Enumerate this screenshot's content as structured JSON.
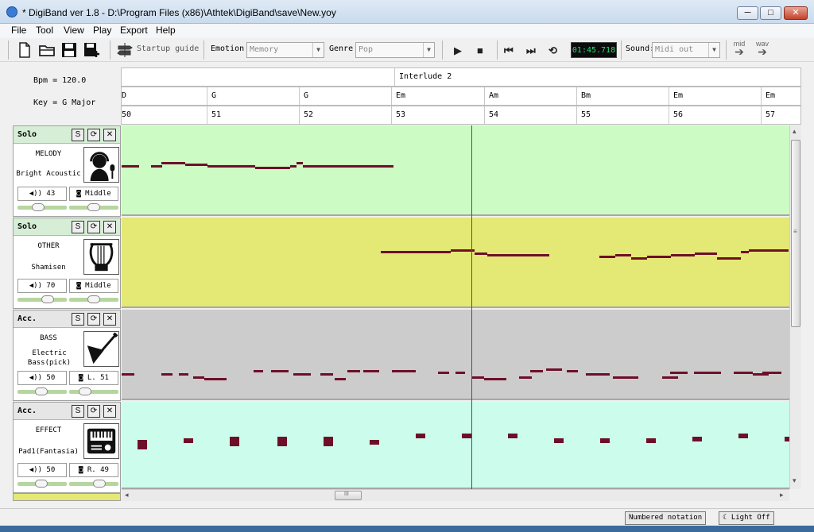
{
  "window": {
    "title": "* DigiBand ver 1.8   - D:\\Program Files (x86)\\Athtek\\DigiBand\\save\\New.yoy",
    "minimize": "─",
    "maximize": "□",
    "close": "✕"
  },
  "menu": [
    "File",
    "Tool",
    "View",
    "Play",
    "Export",
    "Help"
  ],
  "toolbar": {
    "startup_guide": "Startup guide",
    "emotion_label": "Emotion",
    "emotion_value": "Memory",
    "genre_label": "Genre",
    "genre_value": "Pop",
    "time": "01:45.718",
    "sound_label": "Sound:",
    "sound_value": "Midi out",
    "export_mid": "mid",
    "export_wav": "wav"
  },
  "song": {
    "bpm": "Bpm = 120.0",
    "key": "Key =  G  Major"
  },
  "sections": [
    "",
    "Interlude 2"
  ],
  "chords": [
    "D",
    "G",
    "G",
    "Em",
    "Am",
    "Bm",
    "Em",
    "Em"
  ],
  "measures": [
    "50",
    "51",
    "52",
    "53",
    "54",
    "55",
    "56",
    "57"
  ],
  "tracks": [
    {
      "mode": "Solo",
      "name": "MELODY",
      "instrument": "Bright Acoustic",
      "volume": "43",
      "pan": "Middle",
      "color": "#ccfcc4"
    },
    {
      "mode": "Solo",
      "name": "OTHER",
      "instrument": "Shamisen",
      "volume": "70",
      "pan": "Middle",
      "color": "#e4e874"
    },
    {
      "mode": "Acc.",
      "name": "BASS",
      "instrument": "Electric Bass(pick)",
      "volume": "50",
      "pan": "L. 51",
      "color": "#cccccc"
    },
    {
      "mode": "Acc.",
      "name": "EFFECT",
      "instrument": "Pad1(Fantasia)",
      "volume": "50",
      "pan": "R. 49",
      "color": "#ccfcec"
    }
  ],
  "track_buttons": {
    "solo": "S",
    "reset": "⟳",
    "remove": "✕"
  },
  "status": {
    "numbered": "Numbered notation",
    "light": "Light Off"
  },
  "scroll": {
    "grip": "III",
    "left": "◂",
    "right": "▸",
    "up": "▴",
    "down": "▾"
  }
}
